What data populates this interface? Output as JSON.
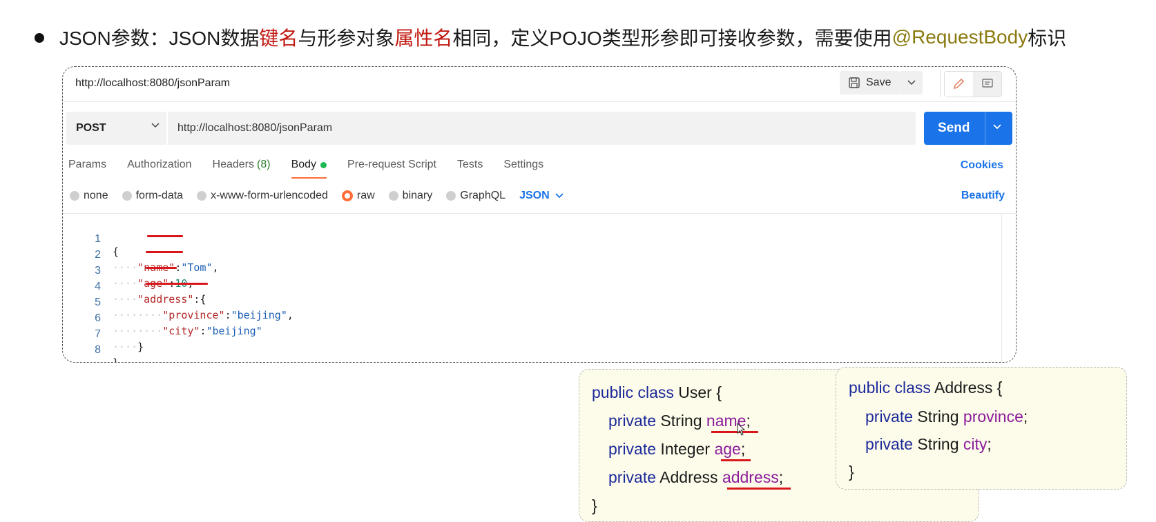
{
  "heading": {
    "part1": "JSON参数：JSON数据",
    "key_name": "键名",
    "part2": "与形参对象",
    "attr_name": "属性名",
    "part3": "相同，定义POJO类型形参即可接收参数，需要使用 ",
    "annotation": "@RequestBody",
    "part4": " 标识"
  },
  "postman": {
    "tab_url": "http://localhost:8080/jsonParam",
    "save_label": "Save",
    "method": "POST",
    "url": "http://localhost:8080/jsonParam",
    "send_label": "Send",
    "tabs": [
      "Params",
      "Authorization",
      "Headers",
      "Body",
      "Pre-request Script",
      "Tests",
      "Settings"
    ],
    "headers_count": "(8)",
    "cookies_label": "Cookies",
    "body_types": [
      "none",
      "form-data",
      "x-www-form-urlencoded",
      "raw",
      "binary",
      "GraphQL"
    ],
    "format": "JSON",
    "beautify_label": "Beautify",
    "editor": {
      "line_numbers": [
        "1",
        "2",
        "3",
        "4",
        "5",
        "6",
        "7",
        "8"
      ],
      "tokens": {
        "open_brace": "{",
        "name_key": "\"name\"",
        "colon": ":",
        "name_val": "\"Tom\"",
        "comma": ",",
        "age_key": "\"age\"",
        "age_val": "10",
        "address_key": "\"address\"",
        "province_key": "\"province\"",
        "province_val": "\"beijing\"",
        "city_key": "\"city\"",
        "city_val": "\"beijing\"",
        "close_brace": "}"
      }
    }
  },
  "user_class": {
    "l1_kw": "public class",
    "l1_name": " User {",
    "l2_kw": "private",
    "l2_type": " String ",
    "l2_field": "name",
    "l3_kw": "private",
    "l3_type": " Integer ",
    "l3_field": "age",
    "l4_kw": "private",
    "l4_type": " Address ",
    "l4_field": "address",
    "semicolon": ";",
    "close": "}"
  },
  "address_class": {
    "l1_kw": "public class",
    "l1_name": " Address {",
    "l2_kw": "private",
    "l2_type": " String ",
    "l2_field": "province",
    "l3_kw": "private",
    "l3_type": " String ",
    "l3_field": "city",
    "semicolon": ";",
    "close": "}"
  },
  "colors": {
    "accent_orange": "#ff6c37",
    "send_blue": "#1a73e8",
    "emphasis_red": "#c0170f",
    "annotation_gold": "#8a7a10"
  }
}
